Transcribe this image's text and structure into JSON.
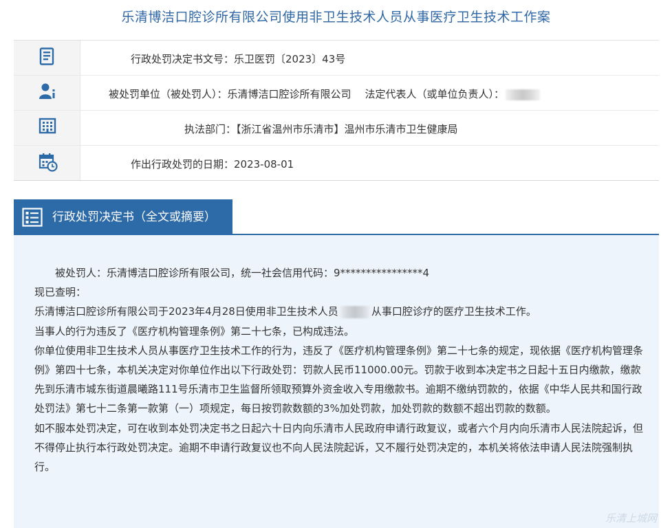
{
  "title": "乐清博洁口腔诊所有限公司使用非卫生技术人员从事医疗卫生技术工作案",
  "info": {
    "decision_no": "行政处罚决定书文号：乐卫医罚〔2023〕43号",
    "party": "被处罚单位（被处罚人）：乐清博洁口腔诊所有限公司",
    "legal_rep": "法定代表人（或单位负责人）：",
    "department": "执法部门：【浙江省温州市乐清市】温州市乐清市卫生健康局",
    "date": "作出行政处罚的日期：2023-08-01"
  },
  "icons": {
    "row1": "document-icon",
    "row2": "person-icon",
    "row3": "building-icon",
    "row4": "calendar-clock-icon",
    "section": "document-list-icon"
  },
  "section": {
    "label": "行政处罚决定书（全文或摘要）"
  },
  "content": {
    "p1": "被处罚人：乐清博洁口腔诊所有限公司，统一社会信用代码：9****************4",
    "p2": "现已查明：",
    "p3a": "乐清博洁口腔诊所有限公司于2023年4月28日使用非卫生技术人员",
    "p3b": "从事口腔诊疗的医疗卫生技术工作。",
    "p4": "当事人的行为违反了《医疗机构管理条例》第二十七条，已构成违法。",
    "p5": "你单位使用非卫生技术人员从事医疗卫生技术工作的行为，违反了《医疗机构管理条例》第二十七条的规定，现依据《医疗机构管理条例》第四十七条，本机关决定对你单位作出以下行政处罚：罚款人民币11000.00元。罚款于收到本决定书之日起十五日内缴款，缴款先到乐清市城东街道晨曦路111号乐清市卫生监督所领取预算外资金收入专用缴款书。逾期不缴纳罚款的，依据《中华人民共和国行政处罚法》第七十二条第一款第（一）项规定，每日按罚款数额的3%加处罚款，加处罚款的数额不超出罚款的数额。",
    "p6": "如不服本处罚决定，可在收到本处罚决定书之日起六十日内向乐清市人民政府申请行政复议，或者六个月内向乐清市人民法院起诉，但不得停止执行本行政处罚决定。逾期不申请行政复议也不向人民法院起诉，又不履行处罚决定的，本机关将依法申请人民法院强制执行。"
  },
  "watermark": "乐清上城网",
  "colors": {
    "title": "#2f67a6",
    "section_bar": "#2d6aa8",
    "panel_bg": "#eef4fb"
  }
}
